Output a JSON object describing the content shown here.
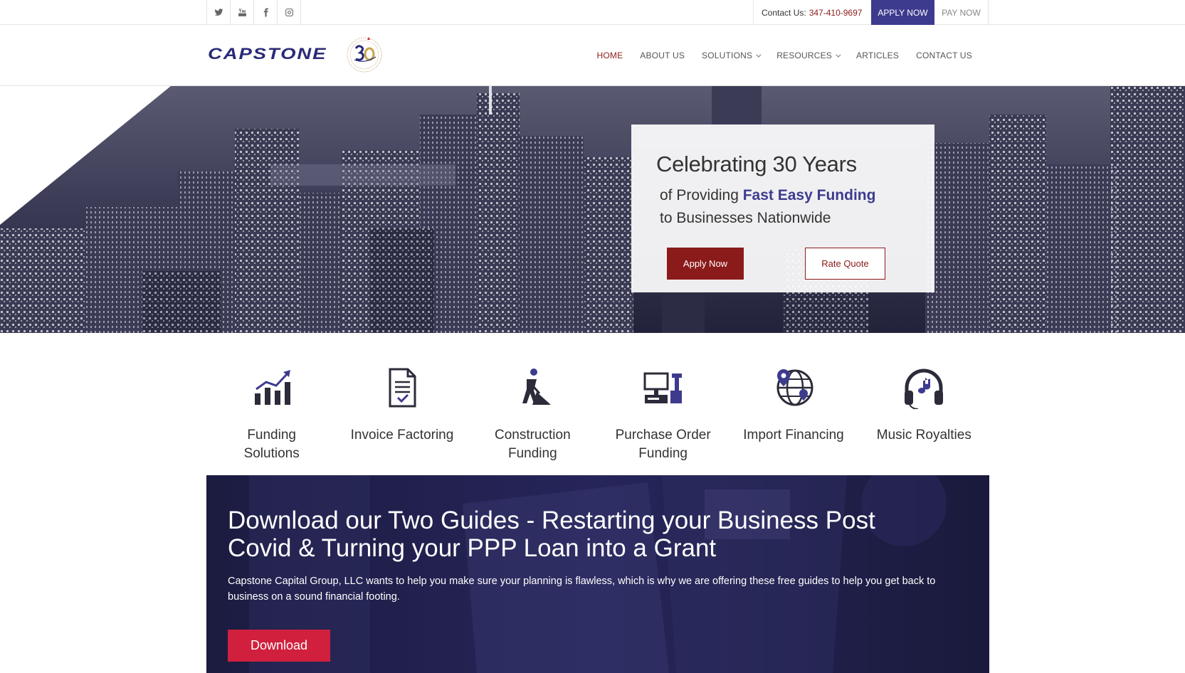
{
  "topbar": {
    "social": [
      {
        "name": "twitter-icon"
      },
      {
        "name": "youtube-icon"
      },
      {
        "name": "facebook-icon"
      },
      {
        "name": "instagram-icon"
      }
    ],
    "contact_label": "Contact Us:",
    "contact_phone": "347-410-9697",
    "apply_label": "APPLY NOW",
    "pay_label": "PAY NOW"
  },
  "header": {
    "logo_text": "CAPSTONE",
    "nav": [
      {
        "label": "HOME",
        "active": true,
        "dropdown": false
      },
      {
        "label": "ABOUT US",
        "active": false,
        "dropdown": false
      },
      {
        "label": "SOLUTIONS",
        "active": false,
        "dropdown": true
      },
      {
        "label": "RESOURCES",
        "active": false,
        "dropdown": true
      },
      {
        "label": "ARTICLES",
        "active": false,
        "dropdown": false
      },
      {
        "label": "CONTACT US",
        "active": false,
        "dropdown": false
      }
    ]
  },
  "hero": {
    "title": "Celebrating 30 Years",
    "line2_prefix": "of Providing ",
    "line2_highlight": "Fast Easy Funding",
    "line3": "to Businesses Nationwide",
    "apply_label": "Apply Now",
    "rate_label": "Rate Quote"
  },
  "services": [
    {
      "label": "Funding Solutions",
      "icon": "growth-chart-icon"
    },
    {
      "label": "Invoice Factoring",
      "icon": "invoice-document-icon"
    },
    {
      "label": "Construction Funding",
      "icon": "construction-worker-icon"
    },
    {
      "label": "Purchase Order Funding",
      "icon": "point-of-sale-icon"
    },
    {
      "label": "Import Financing",
      "icon": "globe-location-icon"
    },
    {
      "label": "Music Royalties",
      "icon": "headphones-music-icon"
    }
  ],
  "guides": {
    "title": "Download our Two Guides - Restarting your Business Post Covid & Turning your PPP Loan into a Grant",
    "text": "Capstone Capital Group, LLC wants to help you make sure your planning is flawless, which is why we are offering these free guides to help you get back to business on a sound financial footing.",
    "download_label": "Download"
  },
  "colors": {
    "brand_navy": "#3d3b8e",
    "brand_maroon": "#8b1a1a",
    "download_red": "#d0203d",
    "banner_bg": "#1e1d44"
  }
}
